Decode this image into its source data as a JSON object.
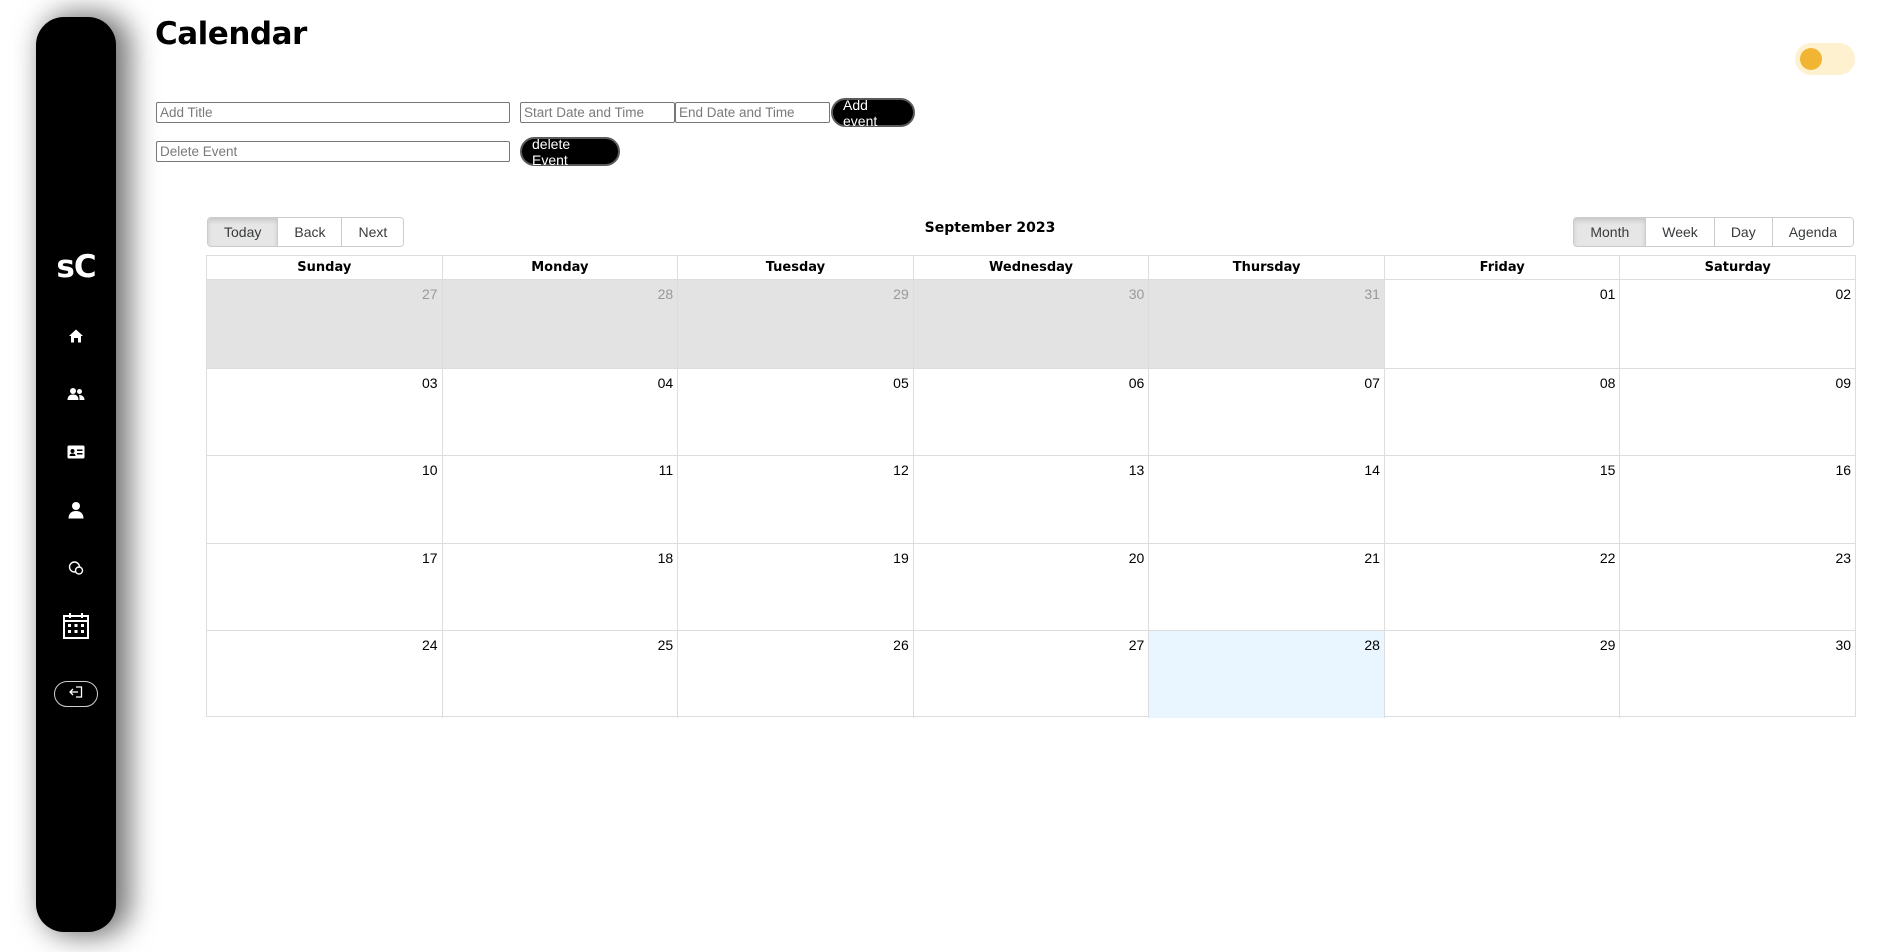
{
  "sidebar": {
    "logo": "sC",
    "items": [
      {
        "icon": "home-icon"
      },
      {
        "icon": "users-icon"
      },
      {
        "icon": "id-card-icon"
      },
      {
        "icon": "user-icon"
      },
      {
        "icon": "chat-icon"
      },
      {
        "icon": "calendar-icon"
      }
    ],
    "logout_icon": "logout-icon"
  },
  "page": {
    "title": "Calendar"
  },
  "theme_toggle": {
    "state": "light",
    "knob_color": "#f2b533",
    "track_color": "#fdf1d0"
  },
  "form": {
    "title_placeholder": "Add Title",
    "start_placeholder": "Start Date and Time",
    "end_placeholder": "End Date and Time",
    "add_label": "Add event",
    "delete_placeholder": "Delete Event",
    "delete_label": "delete Event"
  },
  "calendar": {
    "nav": {
      "today": "Today",
      "back": "Back",
      "next": "Next"
    },
    "label": "September 2023",
    "views": {
      "month": "Month",
      "week": "Week",
      "day": "Day",
      "agenda": "Agenda"
    },
    "active_view": "Month",
    "weekdays": [
      "Sunday",
      "Monday",
      "Tuesday",
      "Wednesday",
      "Thursday",
      "Friday",
      "Saturday"
    ],
    "weeks": [
      [
        "27",
        "28",
        "29",
        "30",
        "31",
        "01",
        "02"
      ],
      [
        "03",
        "04",
        "05",
        "06",
        "07",
        "08",
        "09"
      ],
      [
        "10",
        "11",
        "12",
        "13",
        "14",
        "15",
        "16"
      ],
      [
        "17",
        "18",
        "19",
        "20",
        "21",
        "22",
        "23"
      ],
      [
        "24",
        "25",
        "26",
        "27",
        "28",
        "29",
        "30"
      ]
    ],
    "off_range_days": [
      [
        0,
        0
      ],
      [
        0,
        1
      ],
      [
        0,
        2
      ],
      [
        0,
        3
      ],
      [
        0,
        4
      ]
    ],
    "today_cell": [
      4,
      4
    ],
    "colors": {
      "off_range": "#e3e3e3",
      "today": "#eaf6ff"
    }
  }
}
